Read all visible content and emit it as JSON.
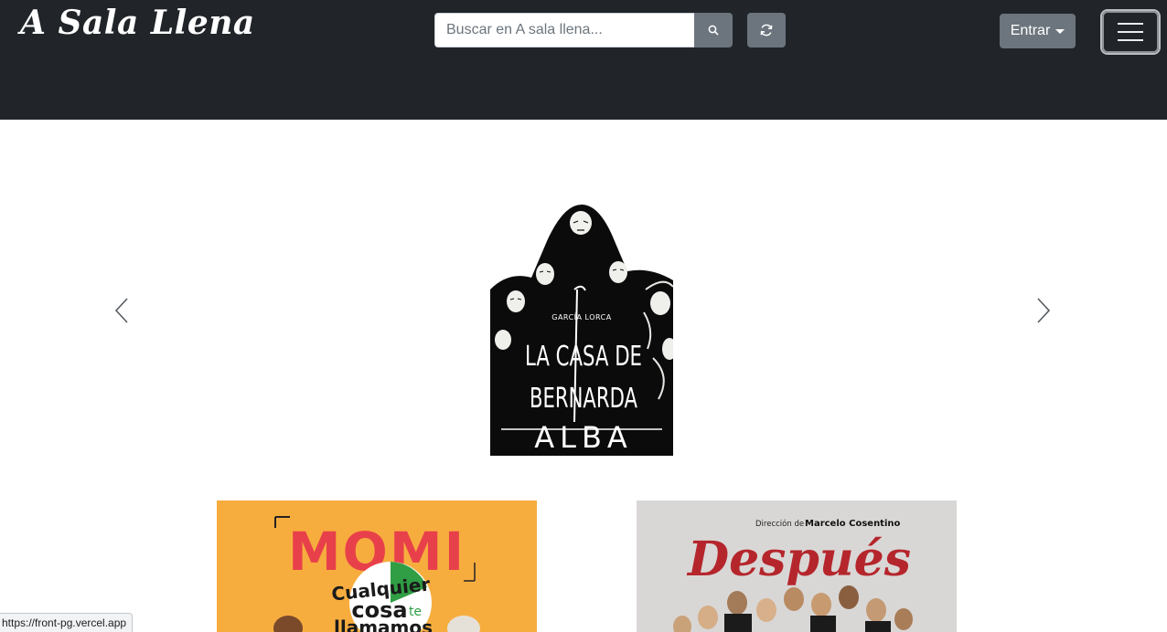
{
  "navbar": {
    "brand": "A Sala Llena",
    "search_placeholder": "Buscar en A sala llena...",
    "login_label": "Entrar"
  },
  "colors": {
    "navbar_bg": "#212529",
    "button_gray": "#6c757d",
    "momi_orange": "#f7ad3e",
    "momi_red": "#e8404a",
    "despues_red": "#b5262c"
  },
  "icons": {
    "search": "search-icon",
    "refresh": "refresh-icon",
    "menu": "hamburger-icon",
    "prev": "chevron-left-icon",
    "next": "chevron-right-icon"
  },
  "carousel": {
    "slide": {
      "author": "GARCÍA LORCA",
      "title_line1": "LA CASA DE",
      "title_line2": "BERNARDA",
      "title_line3": "ALBA"
    }
  },
  "cards": [
    {
      "title": "MOMI",
      "tagline_1": "Cualquier",
      "tagline_2": "cosa",
      "tagline_3": "te",
      "tagline_4": "llamamos"
    },
    {
      "credit_prefix": "Dirección de",
      "credit_name": "Marcelo Cosentino",
      "title": "Después"
    }
  ],
  "status_bar": {
    "url": "https://front-pg.vercel.app"
  }
}
